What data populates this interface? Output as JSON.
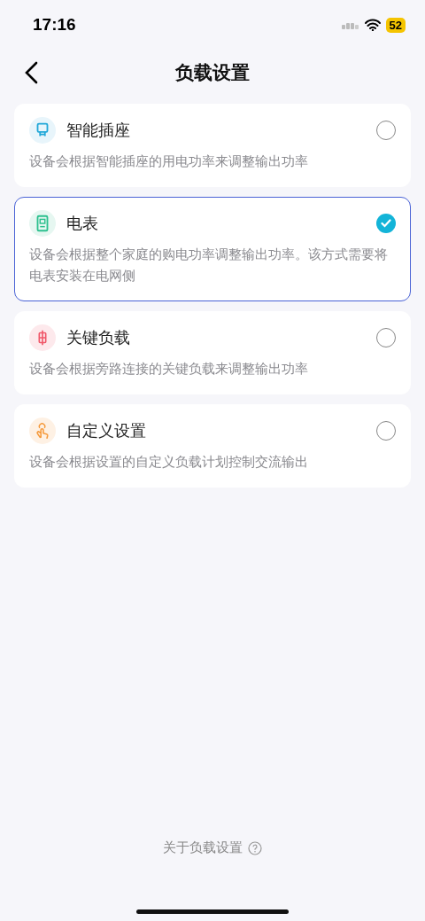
{
  "status_bar": {
    "time": "17:16",
    "battery": "52"
  },
  "nav": {
    "title": "负载设置"
  },
  "options": [
    {
      "kind": "socket",
      "title": "智能插座",
      "description": "设备会根据智能插座的用电功率来调整输出功率",
      "selected": false
    },
    {
      "kind": "meter",
      "title": "电表",
      "description": "设备会根据整个家庭的购电功率调整输出功率。该方式需要将电表安装在电网侧",
      "selected": true
    },
    {
      "kind": "load",
      "title": "关键负载",
      "description": "设备会根据旁路连接的关键负载来调整输出功率",
      "selected": false
    },
    {
      "kind": "hand",
      "title": "自定义设置",
      "description": "设备会根据设置的自定义负载计划控制交流输出",
      "selected": false
    }
  ],
  "footer": {
    "link": "关于负载设置"
  }
}
